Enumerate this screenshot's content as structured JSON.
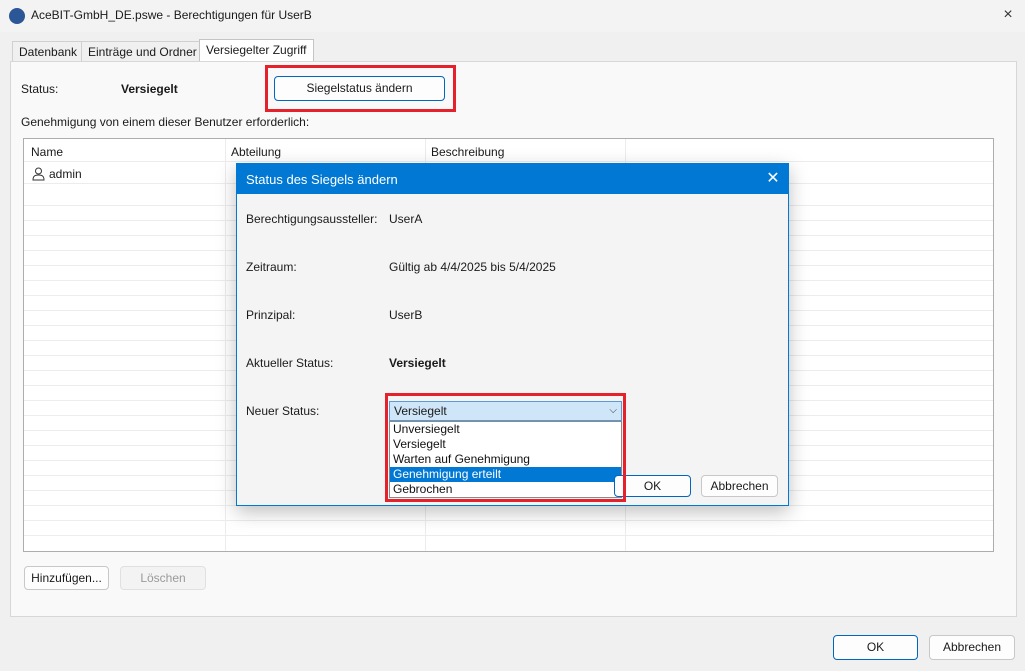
{
  "window": {
    "title": "AceBIT-GmbH_DE.pswe - Berechtigungen für UserB",
    "close_icon": "×"
  },
  "tabs": [
    {
      "label": "Datenbank"
    },
    {
      "label": "Einträge und Ordner"
    },
    {
      "label": "Versiegelter Zugriff",
      "active": true
    }
  ],
  "panel": {
    "status_label": "Status:",
    "status_value": "Versiegelt",
    "change_button": "Siegelstatus ändern",
    "approval_text": "Genehmigung von einem dieser Benutzer erforderlich:",
    "columns": [
      "Name",
      "Abteilung",
      "Beschreibung"
    ],
    "rows": [
      {
        "name": "admin",
        "department": "",
        "description": ""
      }
    ],
    "add_button": "Hinzufügen...",
    "delete_button": "Löschen"
  },
  "dialog": {
    "title": "Status des Siegels ändern",
    "issuer_label": "Berechtigungsaussteller:",
    "issuer_value": "UserA",
    "period_label": "Zeitraum:",
    "period_value": "Gültig ab 4/4/2025 bis 5/4/2025",
    "principal_label": "Prinzipal:",
    "principal_value": "UserB",
    "current_label": "Aktueller Status:",
    "current_value": "Versiegelt",
    "new_label": "Neuer Status:",
    "new_value": "Versiegelt",
    "options": [
      "Unversiegelt",
      "Versiegelt",
      "Warten auf Genehmigung",
      "Genehmigung erteilt",
      "Gebrochen"
    ],
    "highlighted_option": "Genehmigung erteilt",
    "ok_button": "OK",
    "cancel_button": "Abbrechen",
    "close_icon": "✕"
  },
  "footer": {
    "ok_button": "OK",
    "cancel_button": "Abbrechen"
  },
  "colors": {
    "accent": "#0078d4",
    "highlight": "#e5222b"
  }
}
